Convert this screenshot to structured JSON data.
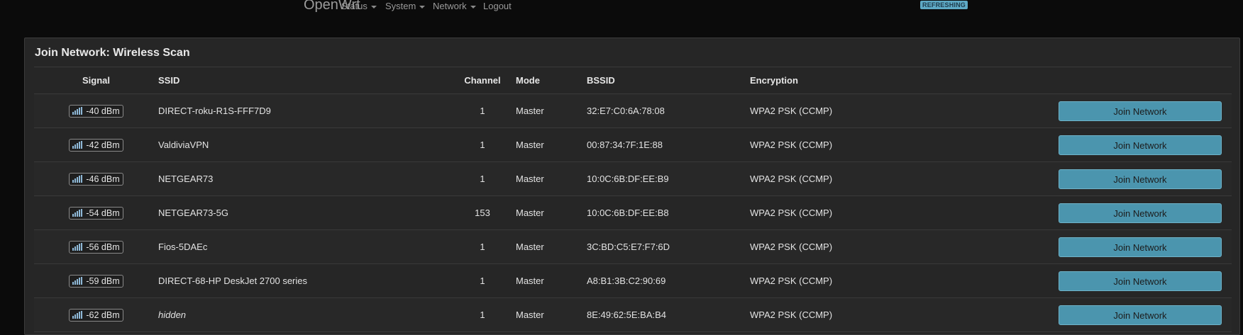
{
  "nav": {
    "brand": "OpenWrt",
    "menus": [
      {
        "label": "Status",
        "caret": true
      },
      {
        "label": "System",
        "caret": true
      },
      {
        "label": "Network",
        "caret": true
      },
      {
        "label": "Logout",
        "caret": false
      }
    ],
    "badge": "REFRESHING"
  },
  "panel": {
    "title": "Join Network: Wireless Scan",
    "columns": {
      "signal": "Signal",
      "ssid": "SSID",
      "channel": "Channel",
      "mode": "Mode",
      "bssid": "BSSID",
      "encryption": "Encryption"
    },
    "rows": [
      {
        "signal": "-40 dBm",
        "ssid": "DIRECT-roku-R1S-FFF7D9",
        "channel": "1",
        "mode": "Master",
        "bssid": "32:E7:C0:6A:78:08",
        "encryption": "WPA2 PSK (CCMP)",
        "action": "Join Network"
      },
      {
        "signal": "-42 dBm",
        "ssid": "ValdiviaVPN",
        "channel": "1",
        "mode": "Master",
        "bssid": "00:87:34:7F:1E:88",
        "encryption": "WPA2 PSK (CCMP)",
        "action": "Join Network"
      },
      {
        "signal": "-46 dBm",
        "ssid": "NETGEAR73",
        "channel": "1",
        "mode": "Master",
        "bssid": "10:0C:6B:DF:EE:B9",
        "encryption": "WPA2 PSK (CCMP)",
        "action": "Join Network"
      },
      {
        "signal": "-54 dBm",
        "ssid": "NETGEAR73-5G",
        "channel": "153",
        "mode": "Master",
        "bssid": "10:0C:6B:DF:EE:B8",
        "encryption": "WPA2 PSK (CCMP)",
        "action": "Join Network"
      },
      {
        "signal": "-56 dBm",
        "ssid": "Fios-5DAEc",
        "channel": "1",
        "mode": "Master",
        "bssid": "3C:BD:C5:E7:F7:6D",
        "encryption": "WPA2 PSK (CCMP)",
        "action": "Join Network"
      },
      {
        "signal": "-59 dBm",
        "ssid": "DIRECT-68-HP DeskJet 2700 series",
        "channel": "1",
        "mode": "Master",
        "bssid": "A8:B1:3B:C2:90:69",
        "encryption": "WPA2 PSK (CCMP)",
        "action": "Join Network"
      },
      {
        "signal": "-62 dBm",
        "ssid": "hidden",
        "ssid_hidden": true,
        "channel": "1",
        "mode": "Master",
        "bssid": "8E:49:62:5E:BA:B4",
        "encryption": "WPA2 PSK (CCMP)",
        "action": "Join Network"
      }
    ]
  },
  "icons": {
    "signal": "signal-bars-icon",
    "caret": "caret-down-icon"
  },
  "colors": {
    "page_bg": "#0b0b0b",
    "panel_bg": "#262626",
    "button_bg": "#4b95ae",
    "badge_bg": "#5ea9c5"
  }
}
